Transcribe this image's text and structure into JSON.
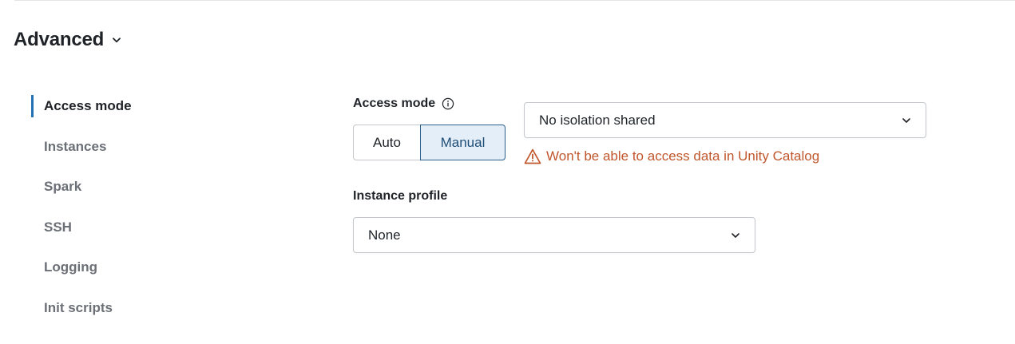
{
  "section": {
    "title": "Advanced"
  },
  "sidebar": {
    "items": [
      {
        "label": "Access mode"
      },
      {
        "label": "Instances"
      },
      {
        "label": "Spark"
      },
      {
        "label": "SSH"
      },
      {
        "label": "Logging"
      },
      {
        "label": "Init scripts"
      }
    ],
    "active_index": 0
  },
  "access_mode": {
    "label": "Access mode",
    "toggle": {
      "options": [
        "Auto",
        "Manual"
      ],
      "selected": "Manual"
    },
    "select_value": "No isolation shared",
    "warning": "Won't be able to access data in Unity Catalog"
  },
  "instance_profile": {
    "label": "Instance profile",
    "select_value": "None"
  },
  "colors": {
    "accent": "#2272b4",
    "warning": "#c0562b",
    "selected_bg": "#e4eef8"
  },
  "icons": {
    "section_toggle": "chevron-down-icon",
    "info": "info-icon",
    "warning": "warning-triangle-icon",
    "select_caret": "chevron-down-icon"
  }
}
